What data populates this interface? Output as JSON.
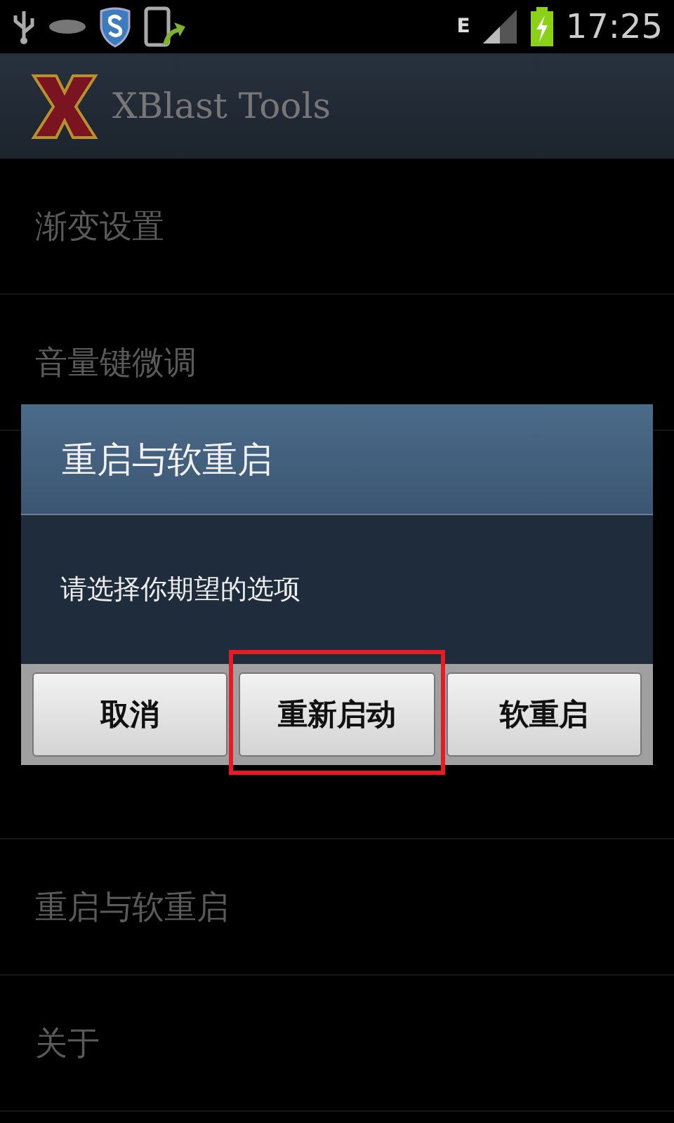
{
  "status_bar": {
    "network": "E",
    "time": "17:25"
  },
  "app_bar": {
    "title": "XBlast Tools"
  },
  "menu_top": [
    {
      "label": "渐变设置"
    },
    {
      "label": "音量键微调"
    }
  ],
  "menu_bottom": [
    {
      "label": "重启与软重启"
    },
    {
      "label": "关于"
    }
  ],
  "dialog": {
    "title": "重启与软重启",
    "message": "请选择你期望的选项",
    "buttons": [
      {
        "label": "取消",
        "highlighted": false
      },
      {
        "label": "重新启动",
        "highlighted": true
      },
      {
        "label": "软重启",
        "highlighted": false
      }
    ]
  }
}
